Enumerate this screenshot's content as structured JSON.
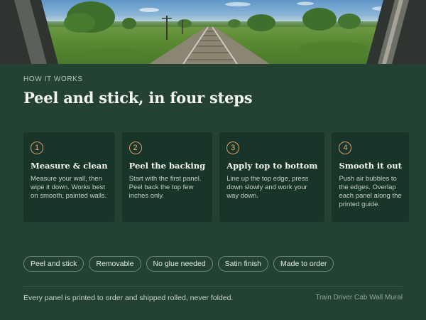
{
  "hero": {
    "image_icon": "railway-track-cab-view"
  },
  "section": {
    "eyebrow": "HOW IT WORKS",
    "title": "Peel and stick, in four steps"
  },
  "steps": [
    {
      "number": "1",
      "title": "Measure & clean",
      "description": "Measure your wall, then wipe it down. Works best on smooth, painted walls."
    },
    {
      "number": "2",
      "title": "Peel the backing",
      "description": "Start with the first panel. Peel back the top few inches only."
    },
    {
      "number": "3",
      "title": "Apply top to bottom",
      "description": "Line up the top edge, press down slowly and work your way down."
    },
    {
      "number": "4",
      "title": "Smooth it out",
      "description": "Push air bubbles to the edges. Overlap each panel along the printed guide."
    }
  ],
  "tags": [
    "Peel and stick",
    "Removable",
    "No glue needed",
    "Satin finish",
    "Made to order"
  ],
  "footer": {
    "note": "Every panel is printed to order and shipped rolled, never folded.",
    "product": "Train Driver Cab Wall Mural"
  },
  "colors": {
    "background": "#234234",
    "card": "#193429",
    "accent": "#d9a06a",
    "tag_border": "#6f8c7d"
  }
}
